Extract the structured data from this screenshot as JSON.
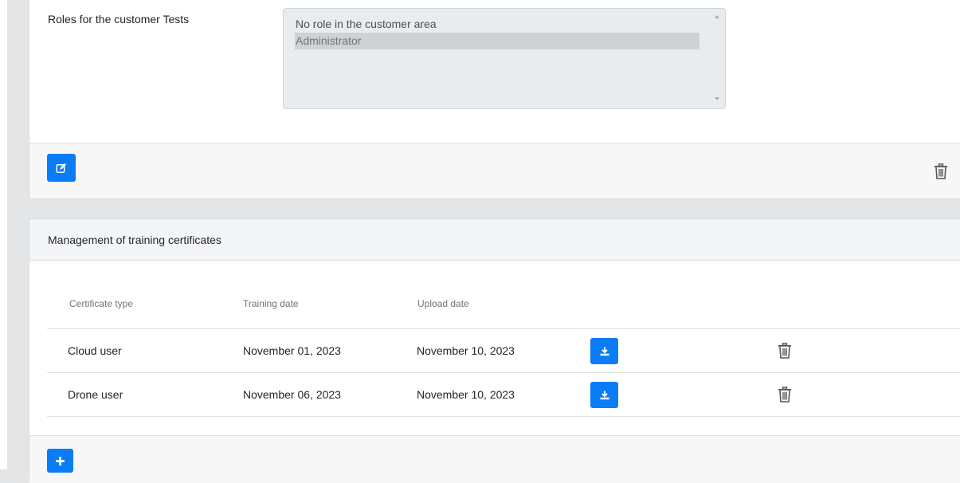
{
  "roles": {
    "label": "Roles for the customer Tests",
    "options": [
      {
        "label": "No role in the customer area",
        "selected": false
      },
      {
        "label": "Administrator",
        "selected": true
      }
    ]
  },
  "footer": {
    "edit_icon": "edit-icon",
    "delete_icon": "trash-icon"
  },
  "certificates": {
    "title": "Management of training certificates",
    "columns": [
      "Certificate type",
      "Training date",
      "Upload date"
    ],
    "rows": [
      {
        "type": "Cloud user",
        "training_date": "November 01, 2023",
        "upload_date": "November 10, 2023"
      },
      {
        "type": "Drone user",
        "training_date": "November 06, 2023",
        "upload_date": "November 10, 2023"
      }
    ],
    "download_icon": "download-icon",
    "add_icon": "plus-icon"
  },
  "colors": {
    "primary": "#0a7cf5",
    "page_bg": "#e4e5e7",
    "card_footer_bg": "#f7f7f7",
    "select_bg": "#e9ecef"
  }
}
